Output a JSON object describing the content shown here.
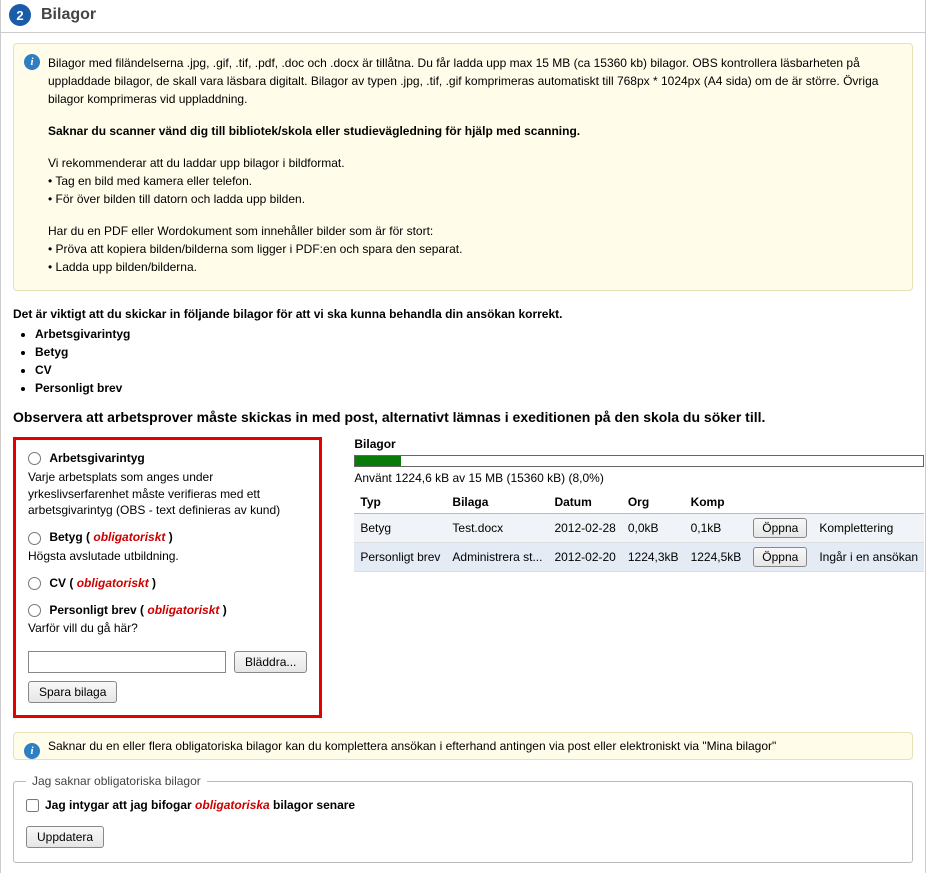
{
  "header": {
    "step_number": "2",
    "title": "Bilagor"
  },
  "info": {
    "p1": "Bilagor med filändelserna .jpg, .gif, .tif, .pdf, .doc och .docx är tillåtna. Du får ladda upp max 15 MB (ca 15360 kb) bilagor. OBS kontrollera läsbarheten på uppladdade bilagor, de skall vara läsbara digitalt. Bilagor av typen .jpg, .tif, .gif komprimeras automatiskt till 768px * 1024px (A4 sida) om de är större. Övriga bilagor komprimeras vid uppladdning.",
    "p2_bold": "Saknar du scanner vänd dig till bibliotek/skola eller studievägledning för hjälp med scanning.",
    "p3_l1": "Vi rekommenderar att du laddar upp bilagor i bildformat.",
    "p3_l2": "• Tag en bild med kamera eller telefon.",
    "p3_l3": "• För över bilden till datorn och ladda upp bilden.",
    "p4_l1": "Har du en PDF eller Wordokument som innehåller bilder som är för stort:",
    "p4_l2": "• Pröva att kopiera bilden/bilderna som ligger i PDF:en och spara den separat.",
    "p4_l3": "• Ladda upp bilden/bilderna."
  },
  "required": {
    "intro": "Det är viktigt att du skickar in följande bilagor för att vi ska kunna behandla din ansökan korrekt.",
    "items": [
      "Arbetsgivarintyg",
      "Betyg",
      "CV",
      "Personligt brev"
    ]
  },
  "observe_note": "Observera att arbetsprover måste skickas in med post, alternativt lämnas i exeditionen på den skola du söker till.",
  "upload": {
    "options": [
      {
        "title": "Arbetsgivarintyg",
        "oblig": "",
        "desc": "Varje arbetsplats som anges under yrkeslivserfarenhet måste verifieras med ett arbetsgivarintyg (OBS - text definieras av kund)"
      },
      {
        "title": "Betyg",
        "oblig": "obligatoriskt",
        "desc": "Högsta avslutade utbildning."
      },
      {
        "title": "CV",
        "oblig": "obligatoriskt",
        "desc": ""
      },
      {
        "title": "Personligt brev",
        "oblig": "obligatoriskt",
        "desc": "Varför vill du gå här?"
      }
    ],
    "browse_label": "Bläddra...",
    "save_label": "Spara bilaga"
  },
  "table": {
    "title": "Bilagor",
    "progress_pct": 8,
    "usage_text": "Använt 1224,6 kB av 15 MB (15360 kB) (8,0%)",
    "headers": [
      "Typ",
      "Bilaga",
      "Datum",
      "Org",
      "Komp",
      "",
      ""
    ],
    "rows": [
      {
        "typ": "Betyg",
        "bilaga": "Test.docx",
        "datum": "2012-02-28",
        "org": "0,0kB",
        "komp": "0,1kB",
        "btn": "Öppna",
        "status": "Komplettering"
      },
      {
        "typ": "Personligt brev",
        "bilaga": "Administrera st...",
        "datum": "2012-02-20",
        "org": "1224,3kB",
        "komp": "1224,5kB",
        "btn": "Öppna",
        "status": "Ingår i en ansökan"
      }
    ]
  },
  "komp_info": "Saknar du en eller flera obligatoriska bilagor kan du komplettera ansökan i efterhand antingen via post eller elektroniskt via \"Mina bilagor\"",
  "missing": {
    "legend": "Jag saknar obligatoriska bilagor",
    "checkbox_pre": "Jag intygar att jag bifogar ",
    "checkbox_em": "obligatoriska",
    "checkbox_post": " bilagor senare",
    "update_label": "Uppdatera"
  }
}
